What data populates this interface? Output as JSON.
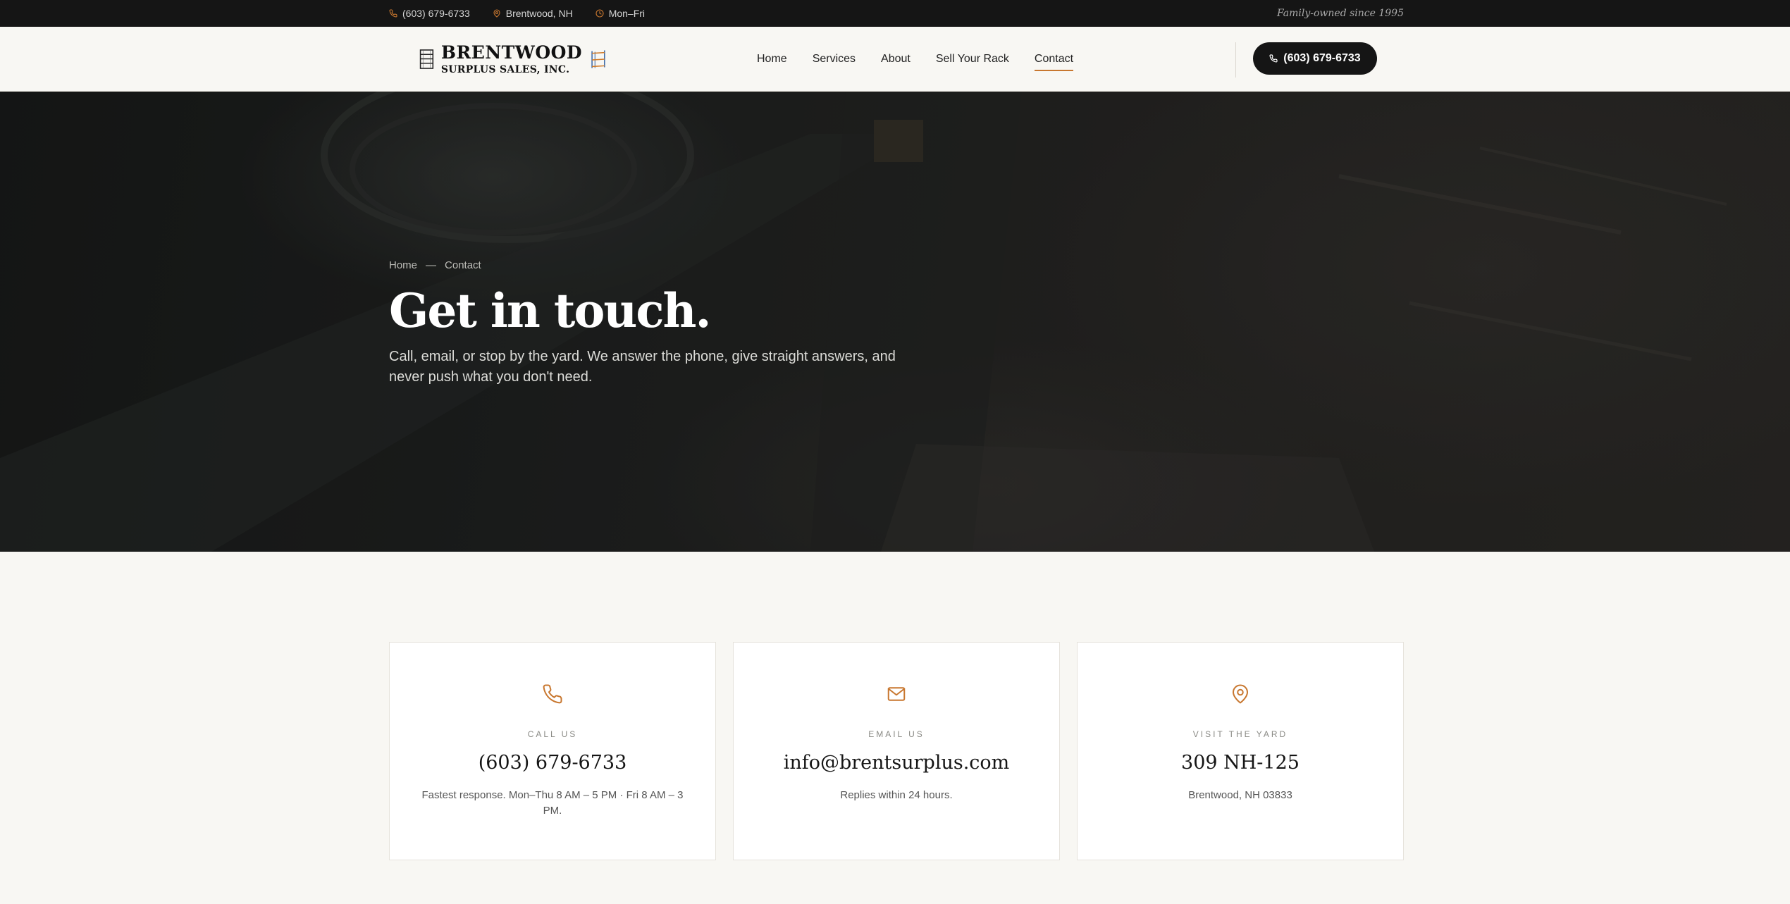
{
  "topbar": {
    "phone": "(603) 679-6733",
    "location": "Brentwood, NH",
    "hours": "Mon–Fri",
    "tagline": "Family-owned since 1995"
  },
  "header": {
    "logo_line1": "BRENTWOOD",
    "logo_line2": "SURPLUS SALES, INC.",
    "nav": [
      {
        "label": "Home"
      },
      {
        "label": "Services"
      },
      {
        "label": "About"
      },
      {
        "label": "Sell Your Rack"
      },
      {
        "label": "Contact"
      }
    ],
    "active_nav": "Contact",
    "call_button": "(603) 679-6733"
  },
  "hero": {
    "breadcrumb_home": "Home",
    "breadcrumb_sep": "—",
    "breadcrumb_current": "Contact",
    "title": "Get in touch.",
    "subtitle": "Call, email, or stop by the yard. We answer the phone, give straight answers, and never push what you don't need."
  },
  "cards": [
    {
      "icon": "phone-icon",
      "label": "CALL US",
      "value": "(603) 679-6733",
      "note": "Fastest response. Mon–Thu 8 AM – 5 PM · Fri 8 AM – 3 PM."
    },
    {
      "icon": "mail-icon",
      "label": "EMAIL US",
      "value": "info@brentsurplus.com",
      "note": "Replies within 24 hours."
    },
    {
      "icon": "map-pin-icon",
      "label": "VISIT THE YARD",
      "value": "309 NH-125",
      "note": "Brentwood, NH 03833"
    }
  ],
  "colors": {
    "accent": "#c8772f",
    "dark": "#151515",
    "background": "#f8f7f3"
  }
}
